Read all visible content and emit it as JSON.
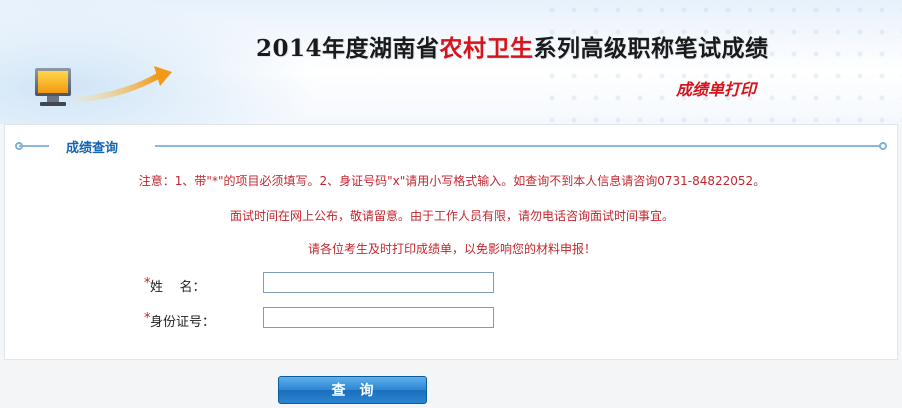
{
  "banner": {
    "title_prefix": "2014年度湖南省",
    "title_highlight": "农村卫生",
    "title_suffix": "系列高级职称笔试成绩",
    "subtitle": "成绩单打印"
  },
  "section": {
    "title": "成绩查询"
  },
  "notices": [
    "注意：1、带\"*\"的项目必须填写。2、身证号码\"x\"请用小写格式输入。如查询不到本人信息请咨询0731-84822052。",
    "面试时间在网上公布，敬请留意。由于工作人员有限，请勿电话咨询面试时间事宜。",
    "请各位考生及时打印成绩单，以免影响您的材料申报！"
  ],
  "form": {
    "required_mark": "*",
    "name_label": "姓    名：",
    "name_value": "",
    "id_label": "身份证号：",
    "id_value": ""
  },
  "buttons": {
    "query_label": "查询"
  },
  "colors": {
    "accent_red": "#d6141b",
    "notice_red": "#c4262e",
    "section_blue": "#1565b0",
    "button_blue": "#2b86d4"
  },
  "icons": {
    "banner_monitor": "computer-monitor-icon",
    "banner_arrow": "upward-arrow-graphic"
  }
}
